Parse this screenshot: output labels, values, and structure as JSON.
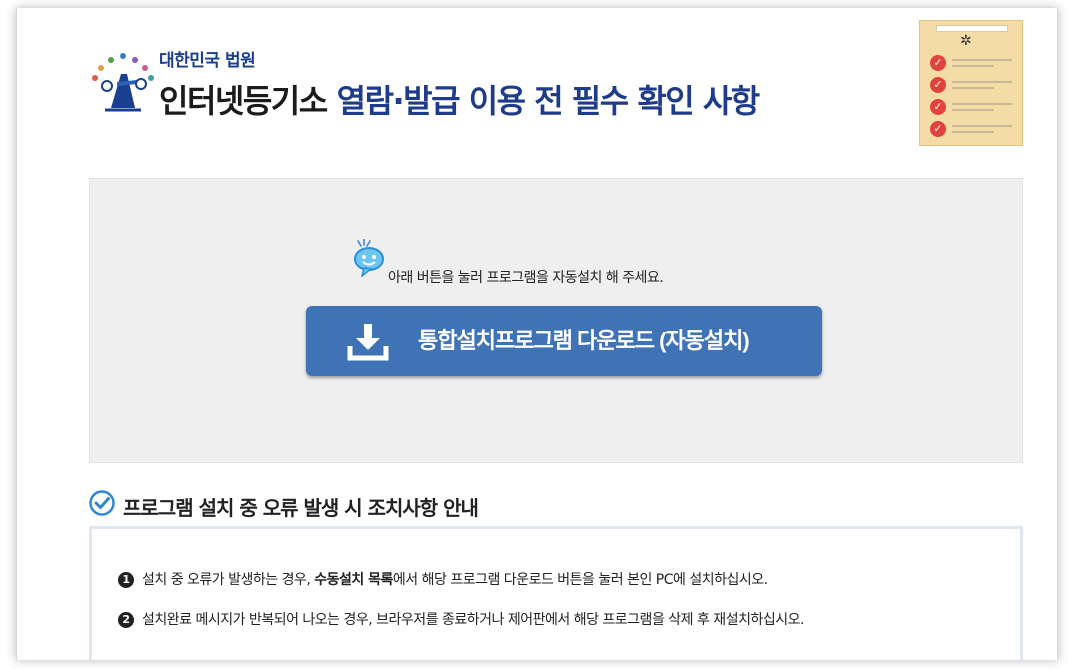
{
  "header": {
    "court_name": "대한민국 법원",
    "title_part1": "인터넷등기소",
    "title_part2": "열람·발급 이용 전 필수 확인 사항"
  },
  "install": {
    "message": "아래 버튼을 눌러 프로그램을 자동설치 해 주세요.",
    "download_button_label": "통합설치프로그램 다운로드 (자동설치)"
  },
  "error_guide": {
    "title": "프로그램 설치 중 오류 발생 시 조치사항 안내",
    "items": [
      {
        "num": "1",
        "text_a": "설치 중 오류가 발생하는 경우,",
        "bold": "수동설치 목록",
        "text_b": "에서 해당 프로그램 다운로드 버튼을 눌러 본인 PC에 설치하십시오."
      },
      {
        "num": "2",
        "text": "설치완료 메시지가 반복되어 나오는 경우, 브라우저를 종료하거나 제어판에서 해당 프로그램을 삭제 후 재설치하십시오."
      }
    ]
  },
  "colors": {
    "title_blue": "#1e3c8a",
    "button_blue": "#3f73b5",
    "box_gray": "#efefef",
    "check_red": "#e0433e"
  },
  "icons": [
    "court-logo-icon",
    "checklist-icon",
    "speech-bubble-icon",
    "download-icon",
    "check-circle-icon"
  ]
}
